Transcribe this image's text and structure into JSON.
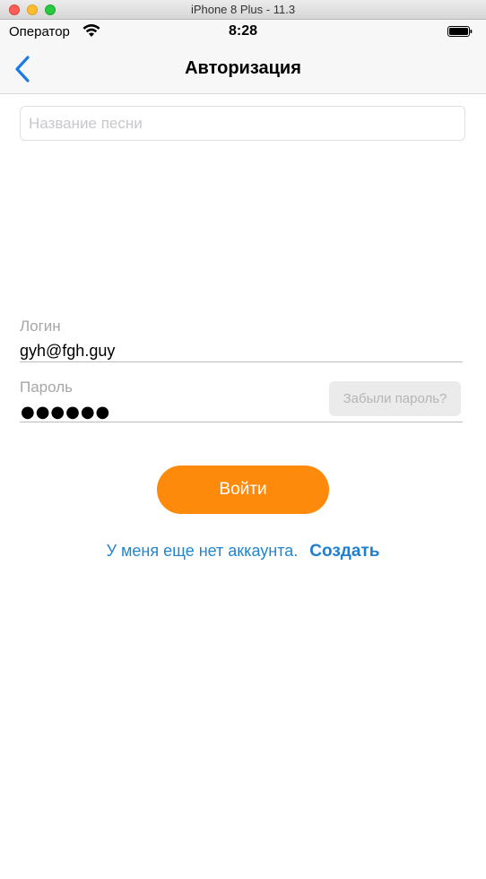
{
  "window": {
    "title": "iPhone 8 Plus - 11.3"
  },
  "status_bar": {
    "carrier": "Оператор",
    "time": "8:28",
    "icons": [
      "wifi-icon",
      "battery-icon"
    ]
  },
  "nav": {
    "title": "Авторизация",
    "back_icon": "chevron-left-icon",
    "accent": "#1a7ce3"
  },
  "search": {
    "placeholder": "Название песни",
    "value": ""
  },
  "login_form": {
    "login_label": "Логин",
    "login_value": "gyh@fgh.guy",
    "password_label": "Пароль",
    "password_value": "●●●●●●",
    "forgot_label": "Забыли пароль?"
  },
  "login_button": {
    "label": "Войти",
    "color": "#fd8a0b"
  },
  "register": {
    "text": "У меня еще нет аккаунта.",
    "link": "Создать",
    "color": "#2285d0"
  }
}
